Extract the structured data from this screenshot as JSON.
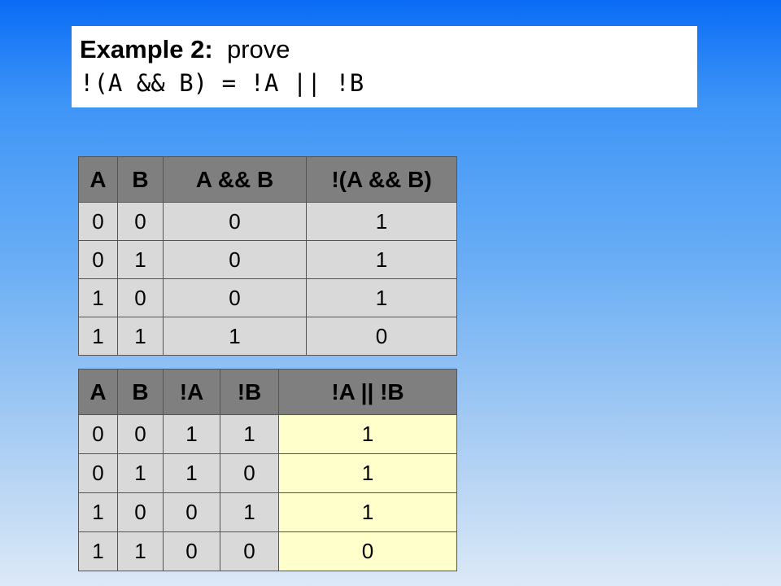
{
  "title": {
    "bold": "Example 2:",
    "rest": "prove",
    "expression": "!(A && B) = !A || !B"
  },
  "table1": {
    "headers": [
      "A",
      "B",
      "A && B",
      "!(A && B)"
    ],
    "rows": [
      [
        "0",
        "0",
        "0",
        "1"
      ],
      [
        "0",
        "1",
        "0",
        "1"
      ],
      [
        "1",
        "0",
        "0",
        "1"
      ],
      [
        "1",
        "1",
        "1",
        "0"
      ]
    ]
  },
  "table2": {
    "headers": [
      "A",
      "B",
      "!A",
      "!B",
      "!A || !B"
    ],
    "rows": [
      [
        "0",
        "0",
        "1",
        "1",
        "1"
      ],
      [
        "0",
        "1",
        "1",
        "0",
        "1"
      ],
      [
        "1",
        "0",
        "0",
        "1",
        "1"
      ],
      [
        "1",
        "1",
        "0",
        "0",
        "0"
      ]
    ]
  },
  "colors": {
    "header_bg": "#7f7f7f",
    "cell_bg": "#d9d9d9",
    "highlight_bg": "#ffffcc"
  }
}
